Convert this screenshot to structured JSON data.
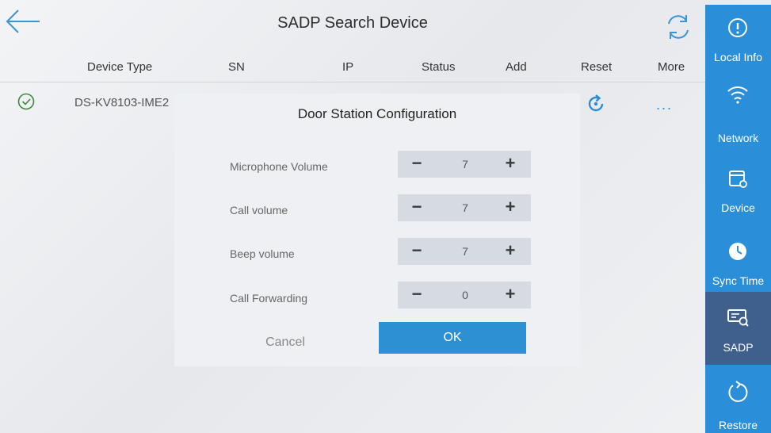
{
  "header": {
    "title": "SADP Search Device"
  },
  "columns": [
    "Device Type",
    "SN",
    "IP",
    "Status",
    "Add",
    "Reset",
    "More"
  ],
  "device_row": {
    "device_type": "DS-KV8103-IME2",
    "more_label": "..."
  },
  "sidebar": {
    "items": [
      {
        "label": "Local Info",
        "icon": "info-icon"
      },
      {
        "label": "Network",
        "icon": "wifi-icon"
      },
      {
        "label": "Device",
        "icon": "device-settings-icon"
      },
      {
        "label": "Sync Time",
        "icon": "clock-icon"
      },
      {
        "label": "SADP",
        "icon": "sadp-search-icon",
        "active": true
      },
      {
        "label": "Restore",
        "icon": "restore-icon"
      }
    ]
  },
  "dialog": {
    "title": "Door Station Configuration",
    "fields": [
      {
        "label": "Microphone Volume",
        "value": "7"
      },
      {
        "label": "Call volume",
        "value": "7"
      },
      {
        "label": "Beep volume",
        "value": "7"
      },
      {
        "label": "Call Forwarding",
        "value": "0"
      }
    ],
    "minus": "−",
    "plus": "+",
    "cancel_label": "Cancel",
    "ok_label": "OK"
  },
  "colors": {
    "accent": "#2a8fd8",
    "active": "#3f5f8d"
  }
}
